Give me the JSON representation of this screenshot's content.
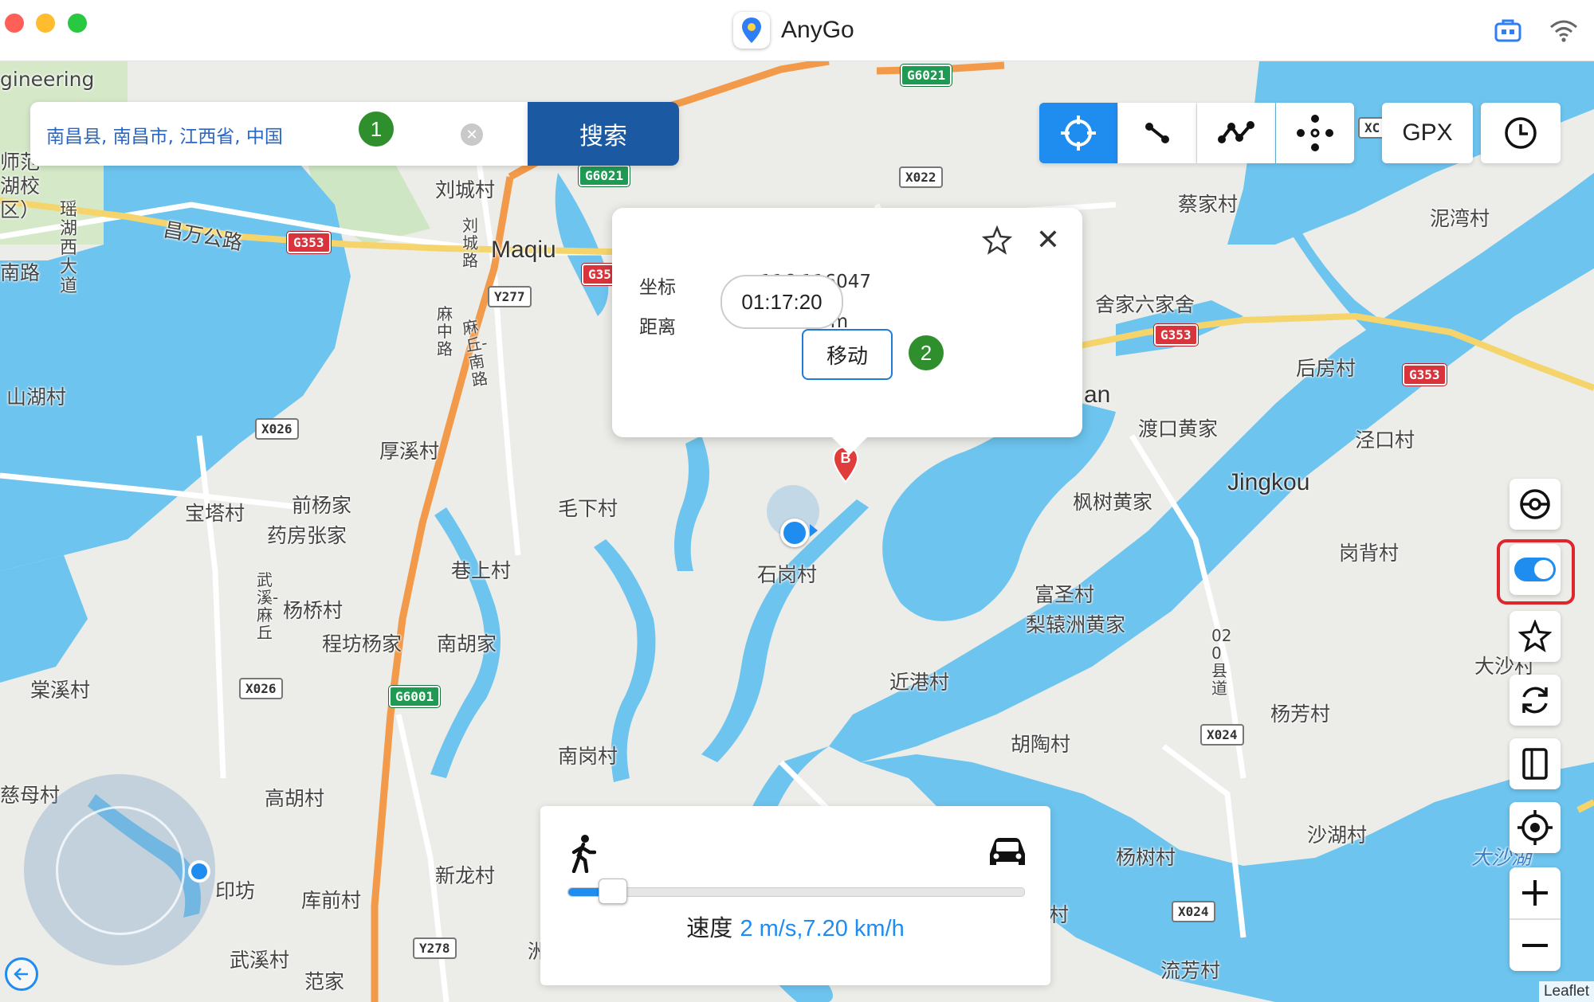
{
  "app": {
    "title": "AnyGo"
  },
  "search": {
    "value": "南昌县, 南昌市, 江西省, 中国",
    "button_label": "搜索",
    "step_badge": "1"
  },
  "toolbar": {
    "gpx_label": "GPX"
  },
  "popup": {
    "coord_label": "坐标",
    "coord_value": "116.116047",
    "distance_label": "距离",
    "distance_value": "655.27 m",
    "time_pill": "01:17:20",
    "move_label": "移动",
    "step_badge": "2"
  },
  "speed": {
    "label": "速度",
    "value": "2 m/s,7.20 km/h",
    "level": 0.07
  },
  "attribution": "Leaflet",
  "destination_marker": "B",
  "map_labels": {
    "engineering": "gineering",
    "campus": "师范\n湖校区）",
    "nanlu": "南路",
    "liucheng": "刘城村",
    "changwan": "昌万公路",
    "maqiu": "Maqiu",
    "yaohu": "瑶湖西大道",
    "liucheng_rd": "刘城路",
    "shanhu": "山湖村",
    "mazhong": "麻中路",
    "mabu": "麻丘-南路",
    "houxi": "厚溪村",
    "baota": "宝塔村",
    "qianyang": "前杨家",
    "yaofang": "药房张家",
    "maoxia": "毛下村",
    "shigang": "石岗村",
    "xiangshang": "巷上村",
    "yangqiao": "杨桥村",
    "wuximaqiu": "武溪-麻丘",
    "chengfang": "程坊杨家",
    "nanhu": "南胡家",
    "tangxi": "棠溪村",
    "nangang": "南岗村",
    "cimu": "慈母村",
    "gaohu": "高胡村",
    "yinfang": "印坊",
    "kuqian": "库前村",
    "xinlong": "新龙村",
    "wuxi": "武溪村",
    "fanjia": "范家",
    "caijia": "蔡家村",
    "niwan": "泥湾村",
    "shejia": "舍家六家舍",
    "houfang": "后房村",
    "an": "an",
    "dukou": "渡口黄家",
    "jingkou": "Jingkou",
    "jingkoucun": "泾口村",
    "fengshu": "枫树黄家",
    "gangbei": "岗背村",
    "fusheng": "富圣村",
    "lizhou": "梨辕洲黄家",
    "jingang": "近港村",
    "dasha": "大沙村",
    "yangfang": "杨芳村",
    "hutao": "胡陶村",
    "xian020": "020县道",
    "shahu": "沙湖村",
    "yangshu": "杨树村",
    "liufang": "流芳村",
    "dashawater": "大沙湖",
    "cun": "村",
    "zhou": "洲"
  },
  "road_shields": {
    "g6021a": "G6021",
    "g6021b": "G6021",
    "g353a": "G353",
    "g35": "G35",
    "g353b": "G353",
    "g353c": "G353",
    "x022": "X022",
    "y277": "Y277",
    "x026a": "X026",
    "x026b": "X026",
    "g6001": "G6001",
    "x024a": "X024",
    "x024b": "X024",
    "y278": "Y278",
    "xo": "XC"
  },
  "colors": {
    "accent": "#1f8cf0",
    "water": "#6dc4ee",
    "search_button": "#1b5aa2",
    "badge": "#2f8f2c",
    "highlight": "#e0262d"
  }
}
